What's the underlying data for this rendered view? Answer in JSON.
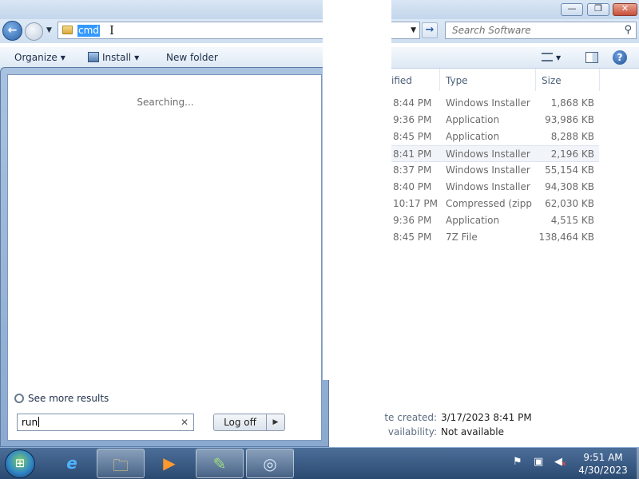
{
  "window": {
    "minimize_glyph": "—",
    "maximize_glyph": "❐",
    "close_glyph": "✕"
  },
  "navbar": {
    "back_glyph": "←",
    "address_text": "cmd",
    "address_dropdown_glyph": "▼",
    "go_glyph": "→",
    "search_placeholder": "Search Software",
    "search_glyph": "⚲"
  },
  "toolbar": {
    "organize_label": "Organize",
    "install_label": "Install",
    "new_folder_label": "New folder",
    "help_glyph": "?"
  },
  "file_list": {
    "headers": {
      "modified": "ified",
      "type": "Type",
      "size": "Size"
    },
    "rows": [
      {
        "date": "8:44 PM",
        "type": "Windows Installer ...",
        "size": "1,868 KB"
      },
      {
        "date": "9:36 PM",
        "type": "Application",
        "size": "93,986 KB"
      },
      {
        "date": "8:45 PM",
        "type": "Application",
        "size": "8,288 KB"
      },
      {
        "date": "8:41 PM",
        "type": "Windows Installer ...",
        "size": "2,196 KB"
      },
      {
        "date": "8:37 PM",
        "type": "Windows Installer ...",
        "size": "55,154 KB"
      },
      {
        "date": "8:40 PM",
        "type": "Windows Installer ...",
        "size": "94,308 KB"
      },
      {
        "date": "10:17 PM",
        "type": "Compressed (zipp...",
        "size": "62,030 KB"
      },
      {
        "date": "9:36 PM",
        "type": "Application",
        "size": "4,515 KB"
      },
      {
        "date": "8:45 PM",
        "type": "7Z File",
        "size": "138,464 KB"
      }
    ],
    "hovered_row_index": 3
  },
  "details": {
    "created_label": "te created:",
    "created_value": "3/17/2023 8:41 PM",
    "availability_label": "vailability:",
    "availability_value": "Not available"
  },
  "start_menu": {
    "status_text": "Searching...",
    "see_more_label": "See more results",
    "search_value": "run",
    "clear_glyph": "✕",
    "log_off_label": "Log off",
    "log_off_arrow_glyph": "▶"
  },
  "taskbar": {
    "items": [
      {
        "name": "internet-explorer-icon",
        "glyph": "e",
        "active": false
      },
      {
        "name": "windows-explorer-icon",
        "glyph": "🗀",
        "active": true
      },
      {
        "name": "media-player-icon",
        "glyph": "▶",
        "active": false
      },
      {
        "name": "notepad-plus-plus-icon",
        "glyph": "✎",
        "active": true
      },
      {
        "name": "installer-disc-icon",
        "glyph": "◎",
        "active": true
      }
    ],
    "clock_time": "9:51 AM",
    "clock_date": "4/30/2023"
  }
}
